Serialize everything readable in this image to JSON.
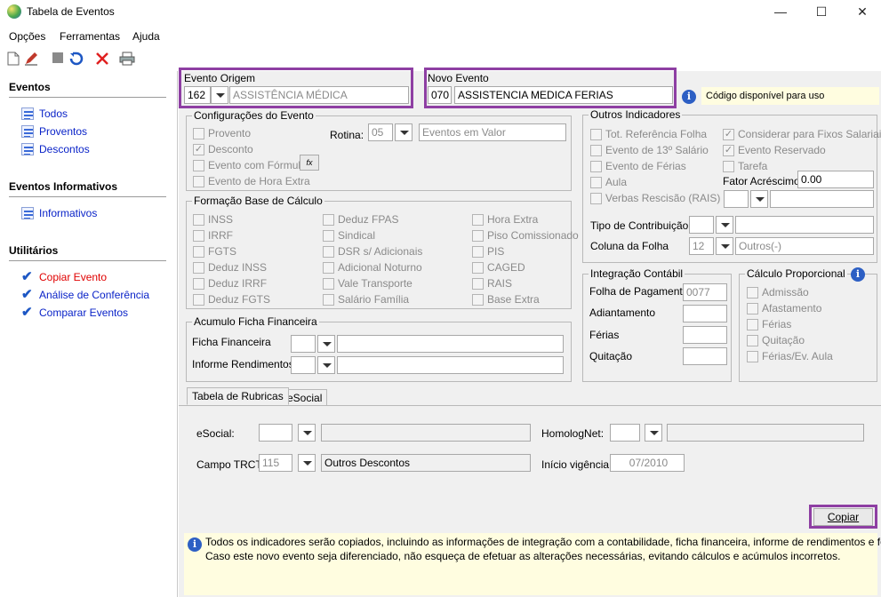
{
  "window": {
    "title": "Tabela de Eventos",
    "minimize": "—",
    "maximize": "☐",
    "close": "✕"
  },
  "menu": {
    "items": [
      "Opções",
      "Ferramentas",
      "Ajuda"
    ]
  },
  "toolbar": {
    "icons": [
      "new-document-icon",
      "edit-icon",
      "stop-icon",
      "undo-icon",
      "delete-icon",
      "print-icon"
    ]
  },
  "sidebar": {
    "sections": [
      {
        "title": "Eventos",
        "items": [
          "Todos",
          "Proventos",
          "Descontos"
        ]
      },
      {
        "title": "Eventos Informativos",
        "items": [
          "Informativos"
        ]
      },
      {
        "title": "Utilitários",
        "items": [
          "Copiar Evento",
          "Análise de Conferência",
          "Comparar Eventos"
        ]
      }
    ],
    "active_color": "#e00000",
    "link_color": "#0a23c8"
  },
  "origem": {
    "label": "Evento Origem",
    "code": "162",
    "desc": "ASSISTÊNCIA MÉDICA"
  },
  "novo": {
    "label": "Novo Evento",
    "code": "070",
    "desc": "ASSISTENCIA MEDICA FERIAS",
    "status": "Código disponível para uso"
  },
  "config": {
    "title": "Configurações do Evento",
    "provento": "Provento",
    "desconto": "Desconto",
    "formula": "Evento com Fórmula",
    "hora_extra": "Evento de Hora Extra",
    "rotina_label": "Rotina:",
    "rotina_code": "05",
    "rotina_desc": "Eventos em Valor",
    "fx": "fx"
  },
  "base": {
    "title": "Formação Base de Cálculo",
    "col1": [
      "INSS",
      "IRRF",
      "FGTS",
      "Deduz INSS",
      "Deduz IRRF",
      "Deduz FGTS"
    ],
    "col2": [
      "Deduz FPAS",
      "Sindical",
      "DSR s/ Adicionais",
      "Adicional Noturno",
      "Vale Transporte",
      "Salário Família"
    ],
    "col3": [
      "Hora Extra",
      "Piso Comissionado",
      "PIS",
      "CAGED",
      "RAIS",
      "Base Extra"
    ]
  },
  "acumulo": {
    "title": "Acumulo Ficha Financeira",
    "ficha": "Ficha Financeira",
    "informe": "Informe Rendimentos"
  },
  "outros": {
    "title": "Outros Indicadores",
    "left": [
      "Tot. Referência Folha",
      "Evento de 13º Salário",
      "Evento de Férias",
      "Aula",
      "Verbas Rescisão (RAIS)"
    ],
    "right": [
      "Considerar para Fixos Salariais",
      "Evento Reservado",
      "Tarefa"
    ],
    "fator_label": "Fator Acréscimo",
    "fator_value": "0.00",
    "tipo_label": "Tipo de Contribuição",
    "coluna_label": "Coluna da Folha",
    "coluna_code": "12",
    "coluna_desc": "Outros(-)"
  },
  "integracao": {
    "title": "Integração Contábil",
    "folha": "Folha de Pagamento",
    "folha_value": "0077",
    "adiantamento": "Adiantamento",
    "ferias": "Férias",
    "quitacao": "Quitação"
  },
  "proporcional": {
    "title": "Cálculo Proporcional",
    "items": [
      "Admissão",
      "Afastamento",
      "Férias",
      "Quitação",
      "Férias/Ev. Aula"
    ]
  },
  "tabs": {
    "items": [
      "Tabela de Rubricas",
      "eSocial"
    ]
  },
  "rubricas": {
    "esocial": "eSocial:",
    "homolog": "HomologNet:",
    "trct_label": "Campo TRCT:",
    "trct_code": "115",
    "trct_desc": "Outros Descontos",
    "vigencia_label": "Início vigência:",
    "vigencia_value": "07/2010"
  },
  "copiar": "Copiar",
  "notice": {
    "line1": "Todos os indicadores serão copiados, incluindo as informações de integração com a contabilidade, ficha financeira, informe de rendimentos e fórmula.",
    "line2": "Caso este novo evento seja diferenciado, não esqueça de efetuar as alterações necessárias, evitando cálculos e acúmulos incorretos."
  },
  "highlight_color": "#8e3fa3"
}
